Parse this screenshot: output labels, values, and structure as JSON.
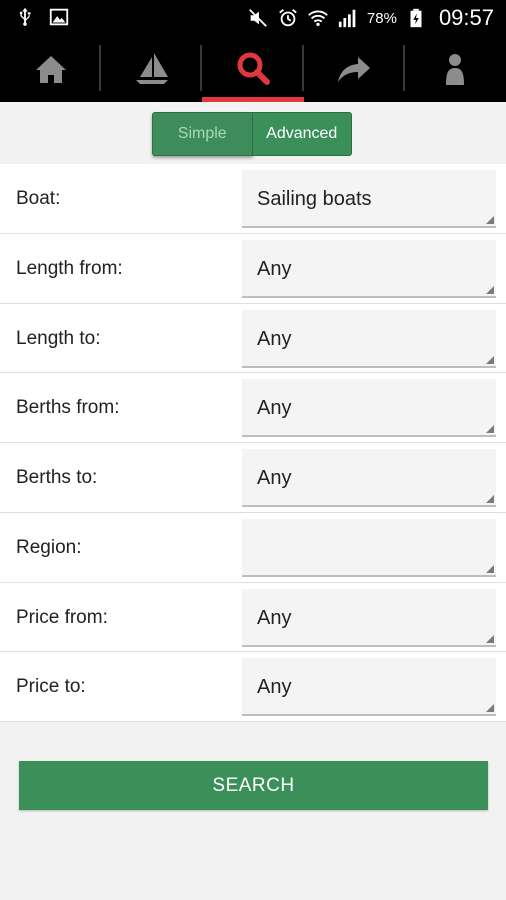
{
  "status_bar": {
    "battery_pct": "78%",
    "time": "09:57",
    "icons": [
      "usb-icon",
      "image-icon",
      "mute-icon",
      "alarm-icon",
      "wifi-icon",
      "signal-icon",
      "battery-icon"
    ]
  },
  "nav": {
    "items": [
      {
        "name": "home",
        "icon": "home-icon"
      },
      {
        "name": "boats",
        "icon": "sailboat-icon"
      },
      {
        "name": "search",
        "icon": "search-icon",
        "active": true
      },
      {
        "name": "share",
        "icon": "share-icon"
      },
      {
        "name": "profile",
        "icon": "person-icon"
      }
    ],
    "active_color": "#e0383e"
  },
  "mode_toggle": {
    "simple_label": "Simple",
    "advanced_label": "Advanced",
    "selected": "Advanced"
  },
  "form": {
    "rows": [
      {
        "label": "Boat:",
        "value": "Sailing boats"
      },
      {
        "label": "Length from:",
        "value": "Any"
      },
      {
        "label": "Length to:",
        "value": "Any"
      },
      {
        "label": "Berths from:",
        "value": "Any"
      },
      {
        "label": "Berths to:",
        "value": "Any"
      },
      {
        "label": "Region:",
        "value": ""
      },
      {
        "label": "Price from:",
        "value": "Any"
      },
      {
        "label": "Price to:",
        "value": "Any"
      }
    ]
  },
  "search_button": {
    "label": "SEARCH"
  },
  "colors": {
    "accent_green": "#3b8f59",
    "active_red": "#e0383e"
  }
}
